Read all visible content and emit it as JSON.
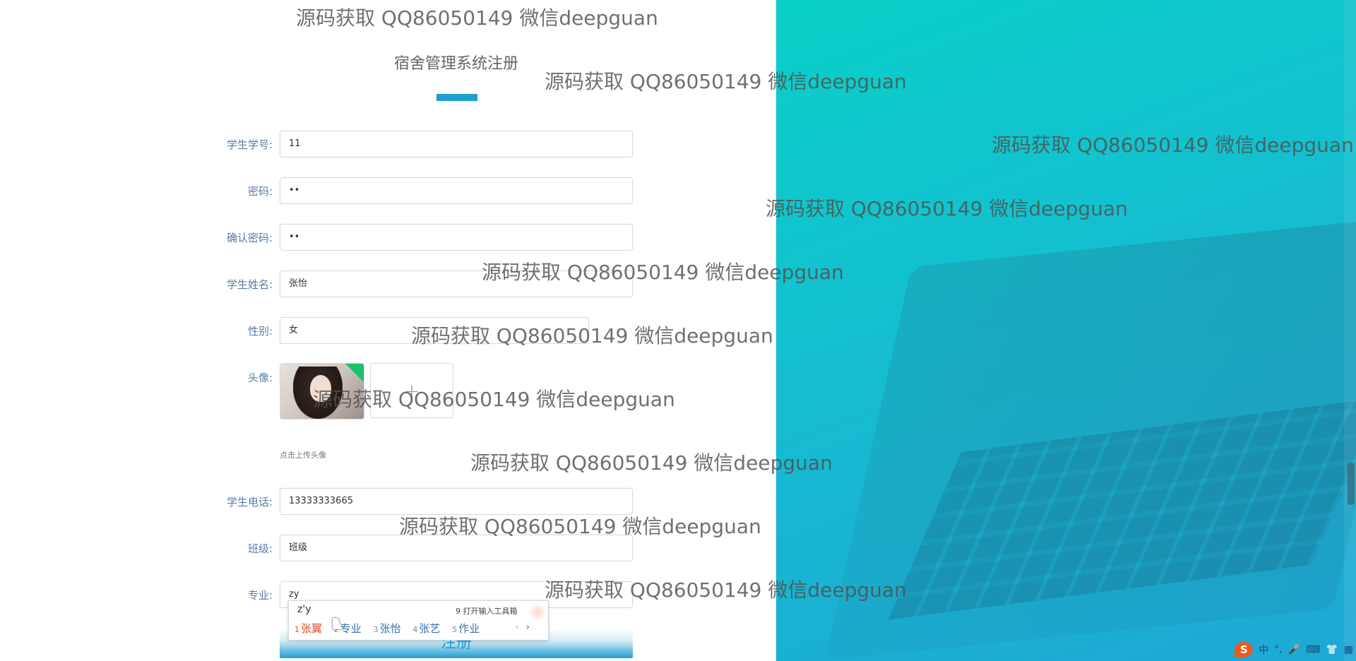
{
  "page": {
    "title": "宿舍管理系统注册",
    "accent_color": "#1e9fd4"
  },
  "form": {
    "fields": [
      {
        "label": "学生学号:",
        "value": "11"
      },
      {
        "label": "密码:",
        "value": "••"
      },
      {
        "label": "确认密码:",
        "value": "••"
      },
      {
        "label": "学生姓名:",
        "value": "张怡"
      },
      {
        "label": "性别:",
        "value": "女"
      },
      {
        "label": "学生电话:",
        "value": "13333333665"
      },
      {
        "label": "班级:",
        "value": "班级"
      },
      {
        "label": "专业:",
        "value": "zy"
      }
    ],
    "avatar": {
      "label": "头像:",
      "upload_hint": "点击上传头像",
      "upload_icon": "plus-icon"
    },
    "submit_label": "注册"
  },
  "ime": {
    "composition": "z'y",
    "tool_hint": "9 打开输入工具箱",
    "candidates": [
      {
        "n": "1",
        "text": "张翼"
      },
      {
        "n": "2",
        "text": "专业"
      },
      {
        "n": "3",
        "text": "张怡"
      },
      {
        "n": "4",
        "text": "张艺"
      },
      {
        "n": "5",
        "text": "作业"
      }
    ],
    "prev": "‹",
    "next": "›"
  },
  "watermark": {
    "text": "源码获取 QQ86050149 微信deepguan"
  },
  "tray": {
    "ime_logo": "S",
    "lang": "中",
    "punct": "°,",
    "icons": [
      "microphone-icon",
      "keyboard-icon",
      "shirt-icon",
      "grid-icon"
    ]
  }
}
